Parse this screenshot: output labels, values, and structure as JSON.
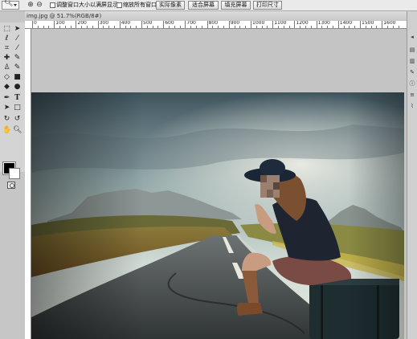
{
  "options_bar": {
    "tool_icon": "zoom-tool-icon",
    "zoom_in_icon": "zoom-in-icon",
    "zoom_out_icon": "zoom-out-icon",
    "checkbox1_label": "调整窗口大小以满屏显示",
    "checkbox2_label": "缩放所有窗口",
    "buttons": [
      "实际像素",
      "适合屏幕",
      "填充屏幕",
      "打印尺寸"
    ]
  },
  "document": {
    "title": "img.jpg @ 51.7%(RGB/8#)",
    "ruler_numbers": [
      "0",
      "100",
      "200",
      "300",
      "400",
      "500",
      "600",
      "700",
      "800",
      "900",
      "1000",
      "1100",
      "1200",
      "1300",
      "1400",
      "1500",
      "1600"
    ]
  },
  "colors": {
    "foreground": "#000000",
    "background": "#ffffff"
  }
}
